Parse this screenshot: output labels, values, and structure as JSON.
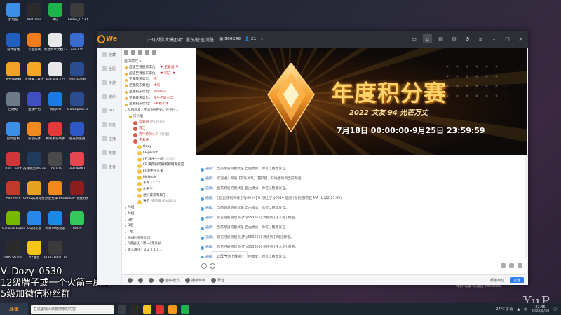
{
  "desktop": {
    "icons": [
      {
        "label": "此电脑",
        "color": "#3d8ee6"
      },
      {
        "label": "WeGame",
        "color": "#2b2b2b"
      },
      {
        "label": "微信",
        "color": "#22b24c"
      },
      {
        "label": "TheIsle_1.53 快捷方式",
        "color": "#3c3c3c"
      },
      {
        "label": "游戏管理",
        "color": "#2060c0"
      },
      {
        "label": "斗鱼游戏",
        "color": "#f17c1b"
      },
      {
        "label": "新建文本文档 (2)",
        "color": "#e8e8e8"
      },
      {
        "label": "Aim Lab",
        "color": "#3a6bd1"
      },
      {
        "label": "雷神加速器",
        "color": "#f2a127"
      },
      {
        "label": "火绒安全软件",
        "color": "#f5a623"
      },
      {
        "label": "新建文本文档",
        "color": "#e8e8e8"
      },
      {
        "label": "TeamSpeak",
        "color": "#2a4d8f"
      },
      {
        "label": "回收站",
        "color": "#6c7a89"
      },
      {
        "label": "直播伴侣",
        "color": "#3f4fbf"
      },
      {
        "label": "腾讯QQ",
        "color": "#1a7be0"
      },
      {
        "label": "TeamSpeak 3",
        "color": "#2a4d8f"
      },
      {
        "label": "控制面板",
        "color": "#3d8ee6"
      },
      {
        "label": "守望先锋",
        "color": "#f08a1e"
      },
      {
        "label": "腾讯手游助手",
        "color": "#e23a3a"
      },
      {
        "label": "雷光加速器",
        "color": "#2d58c4"
      },
      {
        "label": "Riot Client",
        "color": "#d13639"
      },
      {
        "label": "英雄联盟WeGame版",
        "color": "#1f3c5a"
      },
      {
        "label": "The Isle",
        "color": "#4a4a4a"
      },
      {
        "label": "VALORANT",
        "color": "#e6474e"
      },
      {
        "label": "Aim Hero",
        "color": "#c0392b"
      },
      {
        "label": "CFHD高清竞技大区",
        "color": "#e6a21e"
      },
      {
        "label": "守望先锋 Beta",
        "color": "#f08a1e"
      },
      {
        "label": "Dota - 快捷方式",
        "color": "#8a1d1d"
      },
      {
        "label": "GeForce Experience",
        "color": "#76b900"
      },
      {
        "label": "QQ浏览器",
        "color": "#2788e9"
      },
      {
        "label": "网易UU加速器",
        "color": "#1e88e5"
      },
      {
        "label": "KOOK",
        "color": "#34c759"
      },
      {
        "label": "OBS Studio",
        "color": "#2b2b2b"
      },
      {
        "label": "YY语音",
        "color": "#f5c518"
      },
      {
        "label": "PUBG BATTLEGR...",
        "color": "#3a3a3a"
      }
    ]
  },
  "overlay": {
    "line1": "V_Dozy_0530",
    "line2": "12级牌子或一个火箭=房管",
    "line3": "5级加微信粉丝群"
  },
  "app": {
    "brand": "We",
    "title": "[FB] 战队大爆团收：股东/管理/常驻",
    "channel_id": "906246",
    "online_count": "21",
    "window_controls": [
      "minimize",
      "maximize",
      "close"
    ],
    "rail_items": [
      "收藏",
      "全民",
      "手游",
      "娱乐",
      "Nul",
      "交友",
      "主播",
      "英雄",
      "王者"
    ],
    "tree": {
      "mode": "自由模式",
      "rows": [
        {
          "lvl": 1,
          "text": "超级至尊股东席位：",
          "name": "王紫涵",
          "heart": true,
          "style": "r"
        },
        {
          "lvl": 1,
          "text": "超级至尊股东席位：",
          "name": "阿江",
          "heart": true,
          "style": "r"
        },
        {
          "lvl": 1,
          "text": "至尊股东席位：",
          "name": "鸡",
          "style": "r"
        },
        {
          "lvl": 1,
          "text": "至尊股东席位：",
          "name": "术句",
          "style": "r"
        },
        {
          "lvl": 1,
          "text": "至尊股东席位：",
          "name": "Mr.Beak",
          "style": "r"
        },
        {
          "lvl": 1,
          "text": "至尊股东席位：",
          "name": "嗅牛奶的小二",
          "style": "r"
        },
        {
          "lvl": 1,
          "text": "至尊股东席位：",
          "name": "8网秋小沐",
          "style": "r"
        },
        {
          "lvl": 1,
          "text": "队内闭麦：不过9升开始，任何一...",
          "name": "",
          "style": ""
        },
        {
          "lvl": 2,
          "text": "法人组",
          "name": "",
          "style": ""
        },
        {
          "lvl": 3,
          "text": "",
          "name": "蓝漏语",
          "tag": "(Mumbel)",
          "style": "r"
        },
        {
          "lvl": 3,
          "text": "",
          "name": "阿江",
          "style": "r"
        },
        {
          "lvl": 3,
          "text": "",
          "name": "奶牛奶的小二",
          "tag": "[管理]",
          "style": "r"
        },
        {
          "lvl": 3,
          "text": "",
          "name": "王紫涵",
          "style": "r"
        },
        {
          "lvl": 4,
          "text": "Dozy",
          "name": "",
          "style": ""
        },
        {
          "lvl": 4,
          "text": "Elephant",
          "name": "",
          "style": ""
        },
        {
          "lvl": 4,
          "text": "FF 温仲十八星",
          "tag": "(250)",
          "name": "",
          "style": ""
        },
        {
          "lvl": 4,
          "text": "FF 满药别奶果啊啊啊海爱是",
          "name": "",
          "style": ""
        },
        {
          "lvl": 4,
          "text": "FF温牛十八里",
          "name": "",
          "style": ""
        },
        {
          "lvl": 4,
          "text": "Mr.Beak",
          "name": "",
          "style": ""
        },
        {
          "lvl": 4,
          "text": "子琳",
          "tag": "(125)",
          "name": "",
          "style": ""
        },
        {
          "lvl": 4,
          "text": "小君生",
          "name": "",
          "style": ""
        },
        {
          "lvl": 4,
          "text": "想们彼没有躲了",
          "name": "",
          "style": ""
        },
        {
          "lvl": 4,
          "text": "谁忍",
          "tag": "嘟嘟猫  (Fly0614)",
          "name": "",
          "style": ""
        },
        {
          "lvl": 1,
          "text": "AI组",
          "name": "",
          "style": ""
        },
        {
          "lvl": 1,
          "text": "AI组",
          "name": "",
          "style": ""
        },
        {
          "lvl": 1,
          "text": "B组",
          "name": "",
          "style": ""
        },
        {
          "lvl": 1,
          "text": "B组",
          "name": "",
          "style": ""
        },
        {
          "lvl": 1,
          "text": "C组",
          "name": "",
          "style": ""
        },
        {
          "lvl": 1,
          "text": "挑战时限处出房",
          "name": "",
          "style": ""
        },
        {
          "lvl": 1,
          "text": "5排战队-3黑一4黑队长",
          "name": "",
          "style": ""
        },
        {
          "lvl": 1,
          "text": "进人顺序：1 2 2 1 1 1",
          "name": "",
          "style": ""
        }
      ]
    },
    "banner": {
      "title": "年度积分赛",
      "subtitle": "2022 文友 94 光芒万丈",
      "date": "7月18日 00:00:00-9月25日 23:59:59"
    },
    "chat": {
      "messages": [
        {
          "prefix": "通知：",
          "text": "当前频道的模式是 自由模式，你可以随意发言。"
        },
        {
          "prefix": "通知：",
          "text": "欢迎进入频道【欢乐大队】【管理】，开始收听到当前频道。"
        },
        {
          "prefix": "通知：",
          "text": "当前频道的模式是 自由模式，你可以随意发言。"
        },
        {
          "prefix": "通知：",
          "text": "[退出]法则同根 [Fly0614] 8 [骑士]Fly0614 征战 (会员)服务区 MA [L (22:25:45)"
        },
        {
          "prefix": "通知：",
          "text": "当前频道的模式是 自由模式，你可以随意发言。"
        },
        {
          "prefix": "通知：",
          "text": "您已经被管理员 [Fly553665] 调换到 [法人组] 频道。"
        },
        {
          "prefix": "通知：",
          "text": "当前频道的模式是 自由模式，你可以随意发言。"
        },
        {
          "prefix": "通知：",
          "text": "您已经被管理员 [Fly553665] 调换到 [B组] 频道。"
        },
        {
          "prefix": "通知：",
          "text": "您已经被管理员 [Fly553665] 调换到 [法人组] 频道。"
        },
        {
          "prefix": "通知：",
          "text": "当前频道的模式是 自由模式，你可以随意发言。"
        }
      ],
      "popup_hint": "公屏气泡上线啦!"
    },
    "bottom": {
      "items": [
        "自由模式",
        "播放伴奏",
        "录音"
      ],
      "right_label": "频道离线",
      "send": "发送"
    }
  },
  "taskbar": {
    "search_placeholder": "在这里输入你要搜索的内容",
    "weather": "27°C 多云",
    "time": "22:45",
    "date": "2022/8/30",
    "activate_line1": "激活 Windows",
    "activate_line2": "转到\"设置\"以激活 Windows。"
  },
  "yup": "YuP"
}
